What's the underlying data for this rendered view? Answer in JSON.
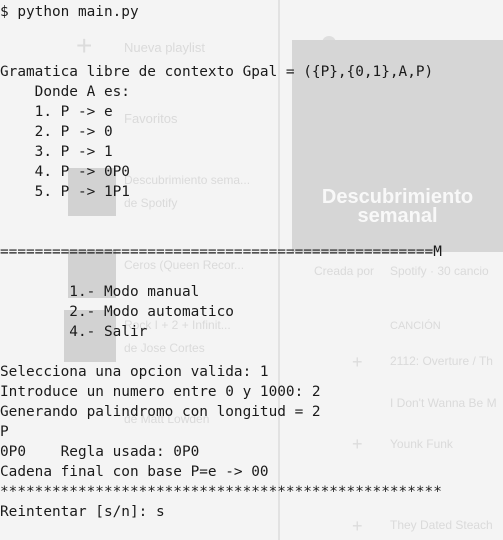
{
  "background_app": {
    "new_playlist": "Nueva playlist",
    "favorites": "Favoritos",
    "weekly_title": "Descubrimiento sema...",
    "weekly_subtitle": "de Spotify",
    "weekly_card_line1": "Descubrimiento",
    "weekly_card_line2": "semanal",
    "created_by": "Creada por",
    "created_by_value": "Spotify · 30 cancio",
    "item2_title": "Ceros (Queen Recor...",
    "item3_title": "Rock I + 2 + Infinit...",
    "item3_subtitle": "de Jose Cortes",
    "item4_subtitle": "de Matt Lowden",
    "song_header": "CANCIÓN",
    "song1": "2112: Overture / Th",
    "song2": "I Don't Wanna Be M",
    "song3": "Younk Funk",
    "song4": "They Dated Steach"
  },
  "terminal": {
    "lines": [
      "$ python main.py",
      "",
      "",
      "Gramatica libre de contexto Gpal = ({P},{0,1},A,P)",
      "    Donde A es:",
      "    1. P -> e",
      "    2. P -> 0",
      "    3. P -> 1",
      "    4. P -> 0P0",
      "    5. P -> 1P1",
      "",
      "",
      "==================================================M",
      "",
      "        1.- Modo manual",
      "        2.- Modo automatico",
      "        4.- Salir",
      "",
      "Selecciona una opcion valida: 1",
      "Introduce un numero entre 0 y 1000: 2",
      "Generando palindromo con longitud = 2",
      "P",
      "0P0    Regla usada: 0P0",
      "Cadena final con base P=e -> 00",
      "***************************************************",
      "",
      "Reintentar [s/n]: s"
    ]
  }
}
